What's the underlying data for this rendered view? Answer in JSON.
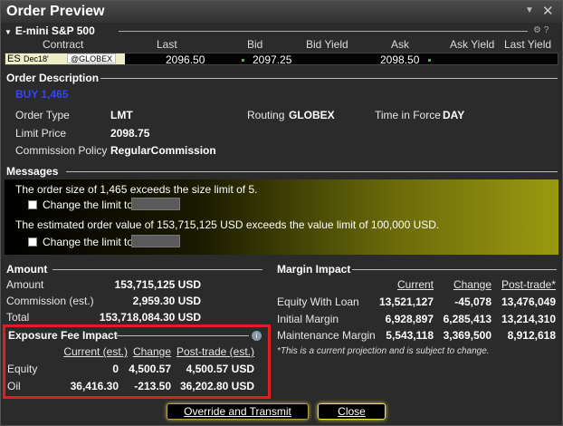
{
  "window": {
    "title": "Order Preview"
  },
  "contract": {
    "title": "E-mini S&P 500",
    "columns": [
      "Contract",
      "Last",
      "Bid",
      "Bid Yield",
      "Ask",
      "Ask Yield",
      "Last Yield"
    ],
    "symbol": "ES",
    "expiry": "Dec18'",
    "exchange": "@GLOBEX",
    "last": "2096.50",
    "bid": "2097.25",
    "ask": "2098.50"
  },
  "order_description": {
    "header": "Order Description",
    "action": "BUY 1,465",
    "order_type_label": "Order Type",
    "order_type": "LMT",
    "routing_label": "Routing",
    "routing": "GLOBEX",
    "tif_label": "Time in Force",
    "tif": "DAY",
    "limit_price_label": "Limit Price",
    "limit_price": "2098.75",
    "commission_policy_label": "Commission Policy",
    "commission_policy": "RegularCommission"
  },
  "messages": {
    "header": "Messages",
    "msg1": "The order size of 1,465 exceeds the size limit of 5.",
    "msg1_check": "Change the limit to",
    "msg2": "The estimated order value of 153,715,125 USD exceeds the value limit of 100,000 USD.",
    "msg2_check": "Change the limit to"
  },
  "amount": {
    "header": "Amount",
    "rows": [
      {
        "label": "Amount",
        "value": "153,715,125 USD"
      },
      {
        "label": "Commission (est.)",
        "value": "2,959.30 USD"
      },
      {
        "label": "Total",
        "value": "153,718,084.30 USD"
      }
    ]
  },
  "margin": {
    "header": "Margin Impact",
    "columns": [
      "Current",
      "Change",
      "Post-trade*"
    ],
    "rows": [
      {
        "label": "Equity With Loan",
        "current": "13,521,127",
        "change": "-45,078",
        "post": "13,476,049"
      },
      {
        "label": "Initial Margin",
        "current": "6,928,897",
        "change": "6,285,413",
        "post": "13,214,310"
      },
      {
        "label": "Maintenance Margin",
        "current": "5,543,118",
        "change": "3,369,500",
        "post": "8,912,618"
      }
    ],
    "footnote": "*This is a current projection and is subject to change."
  },
  "exposure": {
    "header": "Exposure Fee Impact",
    "columns": [
      "Current (est.)",
      "Change",
      "Post-trade (est.)"
    ],
    "rows": [
      {
        "label": "Equity",
        "current": "0",
        "change": "4,500.57",
        "post": "4,500.57 USD"
      },
      {
        "label": "Oil",
        "current": "36,416.30",
        "change": "-213.50",
        "post": "36,202.80 USD"
      }
    ]
  },
  "buttons": {
    "override": "Override and Transmit",
    "close": "Close"
  },
  "colors": {
    "highlight": "#e02020",
    "buy": "#3344ff",
    "accent": "#f0e050"
  }
}
